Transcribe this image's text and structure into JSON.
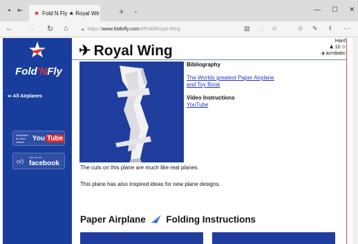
{
  "browser": {
    "tabs": [
      {
        "title": "Fold N Fly ★ Royal Wir",
        "close": "×",
        "active": true
      },
      {
        "title": "",
        "close": "",
        "active": false
      }
    ],
    "new_tab": "+",
    "tab_menu": "⌄",
    "window_controls": {
      "minimize": "—",
      "restore": "☐",
      "close": "✕"
    },
    "url": {
      "prefix": "https://",
      "domain": "www.foldnfly.com",
      "path": "/#/Fold/Royal-Wing"
    }
  },
  "site": {
    "logo": {
      "part1": "Fold",
      "part2": "'N",
      "part3": "Fly"
    },
    "all_airplanes": "⇐ All Airplanes",
    "youtube_badge": {
      "small": "Subscribe for New Videos",
      "you": "You",
      "tube": "Tube"
    },
    "facebook_badge": {
      "like": "Like us on",
      "name": "facebook"
    }
  },
  "plane": {
    "title": "Royal Wing",
    "title_icon": "✈",
    "difficulty": "Hard",
    "distance": "♟ 10 ⟐",
    "tag": "⬗ acrobatic",
    "bibliography_heading": "Bibliography",
    "bibliography_link": "The Worlds greatest Paper Airplane and Toy Book",
    "video_heading": "Video Instructions",
    "video_link": "YouTube",
    "para1": "The cuts on this plane are much like real planes.",
    "para2": "This plane has also inspired ideas for new plane designs.",
    "section_title_left": "Paper Airplane",
    "section_title_right": "Folding Instructions"
  },
  "colors": {
    "sidebar": "#193d9c",
    "link": "#2235c8",
    "accent_red": "#e53238"
  }
}
